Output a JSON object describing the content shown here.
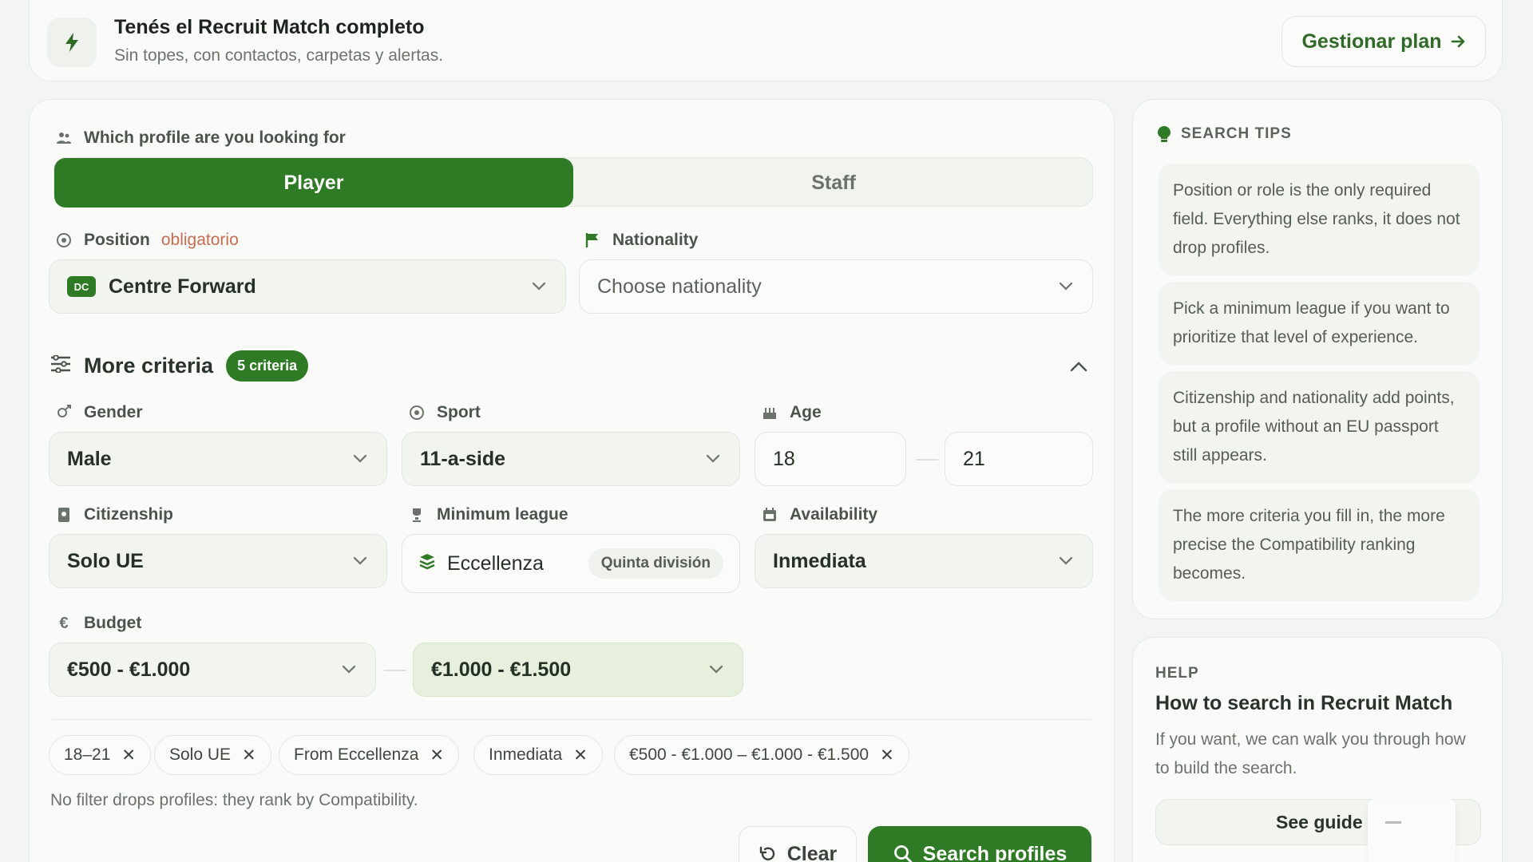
{
  "colors": {
    "accent": "#2f7a24",
    "accent_light": "#e6f0dc",
    "required": "#c86b4f",
    "background": "#f3f5f2"
  },
  "banner": {
    "icon": "bolt-icon",
    "title": "Tenés el Recruit Match completo",
    "subtitle": "Sin topes, con contactos, carpetas y alertas.",
    "manage_label": "Gestionar plan"
  },
  "search": {
    "profile_label": "Which profile are you looking for",
    "tabs": {
      "player": "Player",
      "staff": "Staff"
    },
    "position": {
      "label": "Position",
      "required": "obligatorio",
      "badge": "DC",
      "value": "Centre Forward"
    },
    "nationality": {
      "label": "Nationality",
      "value": "Choose nationality"
    },
    "more_criteria": {
      "label": "More criteria",
      "badge": "5 criteria"
    },
    "gender": {
      "label": "Gender",
      "value": "Male"
    },
    "sport": {
      "label": "Sport",
      "value": "11-a-side"
    },
    "age": {
      "label": "Age",
      "min": "18",
      "max": "21"
    },
    "citizenship": {
      "label": "Citizenship",
      "value": "Solo UE"
    },
    "min_league": {
      "label": "Minimum league",
      "value": "Eccellenza",
      "tag": "Quinta división"
    },
    "availability": {
      "label": "Availability",
      "value": "Inmediata"
    },
    "budget": {
      "label": "Budget",
      "min": "€500 - €1.000",
      "max": "€1.000 - €1.500"
    },
    "chips": [
      "18–21",
      "Solo UE",
      "From Eccellenza",
      "Inmediata",
      "€500 - €1.000 – €1.000 - €1.500"
    ],
    "note": "No filter drops profiles: they rank by Compatibility.",
    "clear_label": "Clear",
    "search_label": "Search profiles"
  },
  "tips": {
    "title": "SEARCH TIPS",
    "items": [
      "Position or role is the only required field. Everything else ranks, it does not drop profiles.",
      "Pick a minimum league if you want to prioritize that level of experience.",
      "Citizenship and nationality add points, but a profile without an EU passport still appears.",
      "The more criteria you fill in, the more precise the Compatibility ranking becomes."
    ]
  },
  "help": {
    "kicker": "HELP",
    "title": "How to search in Recruit Match",
    "description": "If you want, we can walk you through how to build the search.",
    "guide_label": "See guide"
  }
}
